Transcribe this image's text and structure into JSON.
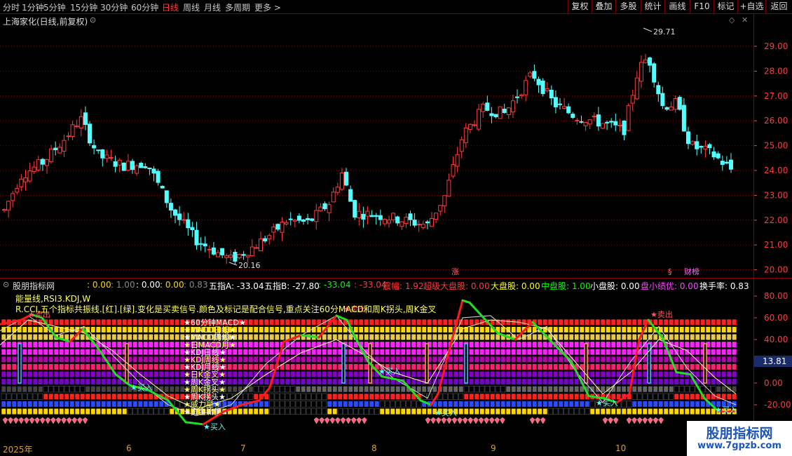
{
  "toolbar": {
    "periods": [
      "分时",
      "1分钟",
      "5分钟",
      "15分钟",
      "30分钟",
      "60分钟",
      "日线",
      "周线",
      "月线",
      "多周期",
      "更多 >"
    ],
    "buttons": [
      "复权",
      "叠加",
      "多股",
      "统计",
      "画线",
      "F10",
      "标记",
      "+自选",
      "返回"
    ]
  },
  "title": "上海家化(日线,前复权)",
  "price_axis": [
    "29.00",
    "28.00",
    "27.00",
    "26.00",
    "25.00",
    "24.00",
    "23.00",
    "22.00",
    "21.00",
    "20.00"
  ],
  "price_marks": {
    "high": "29.71",
    "low": "20.16"
  },
  "tags": {
    "zhang": "涨",
    "yi": "§",
    "caibang": "财榜"
  },
  "indicator": {
    "name": "股朋指标网",
    "header": [
      {
        "t": ": 0.00",
        "c": "#ffd700"
      },
      {
        "t": ": 1.00",
        "c": "#888888"
      },
      {
        "t": ": 0.00",
        "c": "#ffffff"
      },
      {
        "t": ": 0.00",
        "c": "#ffd700"
      },
      {
        "t": ": 0.83",
        "c": "#888888"
      },
      {
        "t": "五指A: -33.04",
        "c": "#ffffff"
      },
      {
        "t": "五指B: -27.80",
        "c": "#ffffff"
      },
      {
        "t": ": -33.04",
        "c": "#00ff00"
      },
      {
        "t": ": -33.04",
        "c": "#ff3b3b"
      },
      {
        "t": "震幅: 1.92",
        "c": "#ff3b3b"
      },
      {
        "t": "超级大盘股: 0.00",
        "c": "#ff3b3b"
      },
      {
        "t": "大盘股: 0.00",
        "c": "#ffff00"
      },
      {
        "t": "中盘股: 1.00",
        "c": "#00ff00"
      },
      {
        "t": "小盘股: 0.00",
        "c": "#ffffff"
      },
      {
        "t": "盘小绩优: 0.00",
        "c": "#ff44ff"
      },
      {
        "t": "换手率: 0.83",
        "c": "#ffffff"
      }
    ],
    "line1": "能量线,RSI3.KDJ,W",
    "line2": "R.CCI,五个指标共振线.[红].[绿].变化是买卖信号.颜色及标记是配合信号,重点关注60分MACD和周K拐头,周K金叉",
    "axis": [
      "80.00",
      "60.00",
      "40.00",
      "20.00",
      "0.00",
      "-20.00"
    ],
    "current_value": "13.81",
    "row_labels": [
      "★60分钟MACD★",
      "★MACD日线★",
      "★MACD周线★",
      "★日MACD月★",
      "★KDJ日线★",
      "★KDJ周线★",
      "★KDJ月线★",
      "★日K金叉★",
      "★周K金叉★",
      "★周K拐头★",
      "★周K拐头★",
      "★威力星★",
      "★资金流量★"
    ],
    "buy": "买入",
    "sell": "卖出"
  },
  "dates": [
    "2025年",
    "6",
    "7",
    "8",
    "9",
    "10"
  ],
  "watermark": {
    "line1": "股朋指标网",
    "line2": "www.7gpzb.com"
  },
  "colors": {
    "up": "#ff3b3b",
    "down": "#54ffff",
    "accent": "#ff3b3b",
    "grid": "#8b0000"
  }
}
